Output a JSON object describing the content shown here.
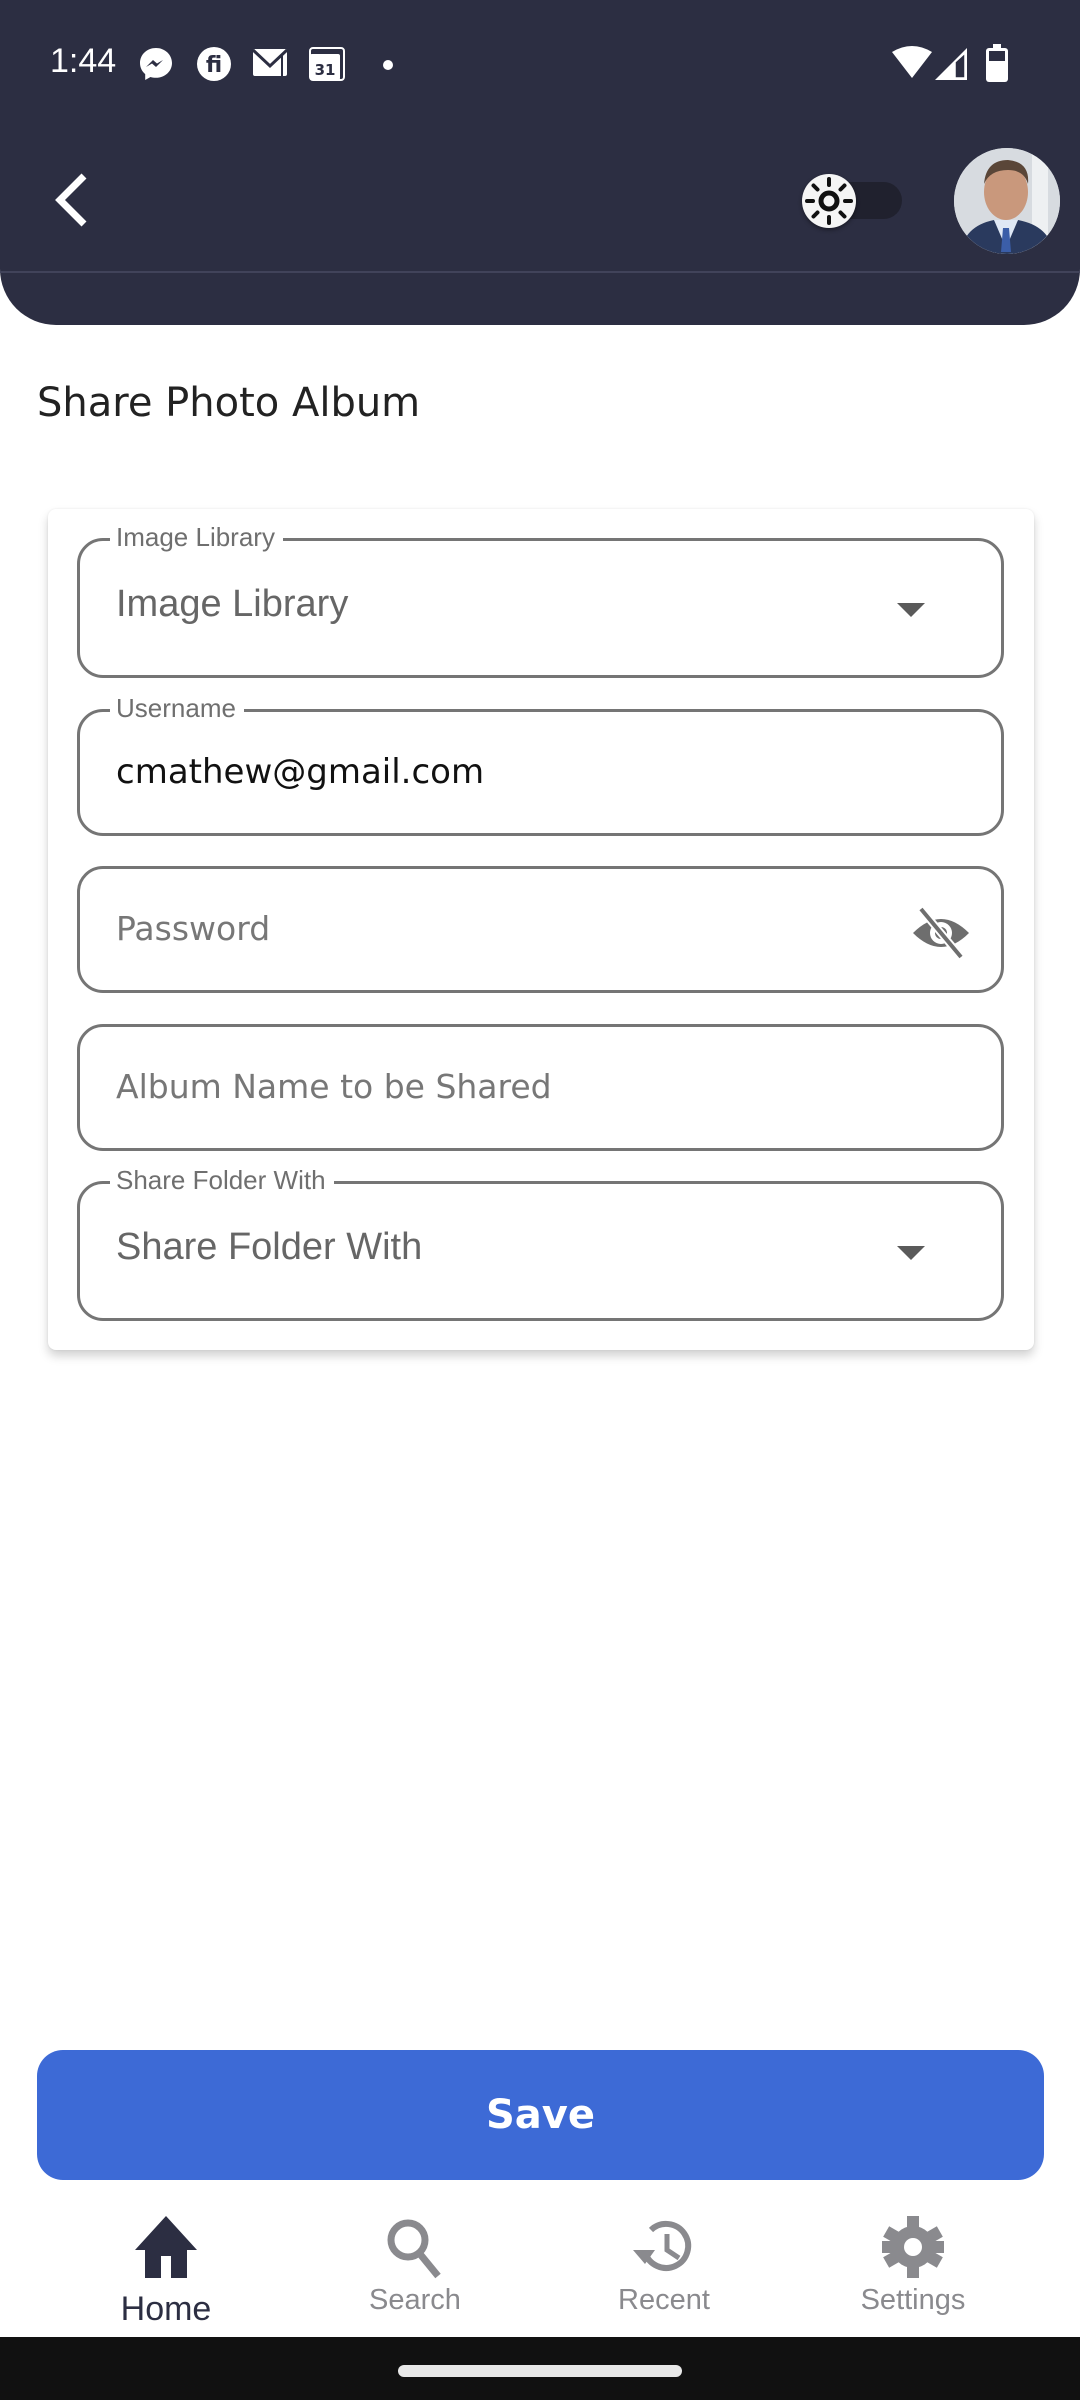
{
  "status_bar": {
    "time": "1:44",
    "notification_icons": [
      "messenger-icon",
      "fi-app-icon",
      "gmail-icon",
      "calendar-icon",
      "dot-icon"
    ],
    "calendar_day": "31",
    "system_icons": [
      "wifi-icon",
      "signal-icon",
      "battery-icon"
    ]
  },
  "header": {
    "back_icon": "chevron-left-icon",
    "theme_toggle": {
      "icon": "sun-icon",
      "state": "light"
    },
    "avatar": "profile-photo"
  },
  "page": {
    "title": "Share Photo Album"
  },
  "form": {
    "image_library": {
      "label": "Image Library",
      "value": "Image Library"
    },
    "username": {
      "label": "Username",
      "value": "cmathew@gmail.com"
    },
    "password": {
      "placeholder": "Password",
      "value": "",
      "visibility_icon": "eye-off-icon"
    },
    "album_name": {
      "placeholder": "Album Name to be Shared",
      "value": ""
    },
    "share_with": {
      "label": "Share Folder With",
      "value": "Share Folder With"
    }
  },
  "actions": {
    "save_label": "Save"
  },
  "bottom_nav": {
    "items": [
      {
        "label": "Home",
        "icon": "home-icon",
        "active": true
      },
      {
        "label": "Search",
        "icon": "search-icon",
        "active": false
      },
      {
        "label": "Recent",
        "icon": "history-icon",
        "active": false
      },
      {
        "label": "Settings",
        "icon": "gear-icon",
        "active": false
      }
    ]
  },
  "colors": {
    "header_bg": "#2c2e42",
    "primary": "#3d6ad6",
    "active_nav": "#2c2e42",
    "inactive_nav": "#8a8a8e",
    "field_border": "#757575"
  }
}
